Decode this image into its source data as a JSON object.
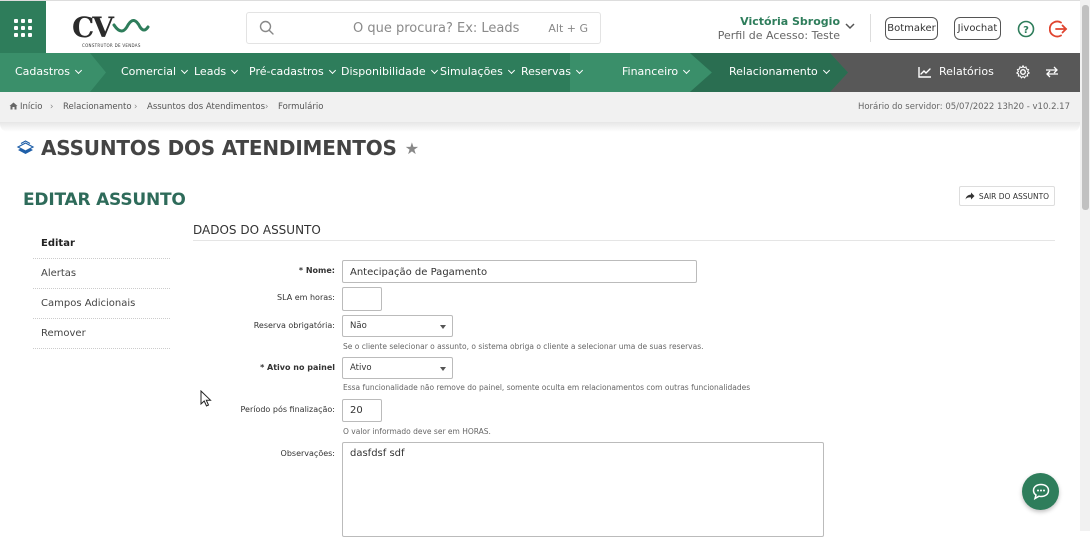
{
  "colors": {
    "brand_green": "#2e7d5b",
    "nav_dark": "#555555",
    "title_green": "#2e6b5a"
  },
  "logo": {
    "brand": "CV",
    "tagline": "CONSTRUTOR DE VENDAS"
  },
  "search": {
    "placeholder": "O que procura? Ex: Leads",
    "shortcut": "Alt + G"
  },
  "user": {
    "name": "Victória Sbrogio",
    "profile": "Perfil de Acesso: Teste"
  },
  "header_buttons": {
    "botmaker": "Botmaker",
    "jivochat": "Jivochat"
  },
  "nav": {
    "items": [
      {
        "label": "Cadastros"
      },
      {
        "label": "Comercial"
      },
      {
        "label": "Leads"
      },
      {
        "label": "Pré-cadastros"
      },
      {
        "label": "Disponibilidade"
      },
      {
        "label": "Simulações"
      },
      {
        "label": "Reservas"
      },
      {
        "label": "Financeiro"
      },
      {
        "label": "Relacionamento"
      }
    ],
    "reports": "Relatórios"
  },
  "breadcrumb": {
    "items": [
      "Início",
      "Relacionamento",
      "Assuntos dos Atendimentos",
      "Formulário"
    ],
    "server_time": "Horário do servidor: 05/07/2022 13h20 - v10.2.17"
  },
  "page": {
    "title": "ASSUNTOS DOS ATENDIMENTOS",
    "section_title": "EDITAR ASSUNTO",
    "exit_button": "SAIR DO ASSUNTO"
  },
  "side_menu": {
    "items": [
      "Editar",
      "Alertas",
      "Campos Adicionais",
      "Remover"
    ],
    "active": "Editar"
  },
  "form": {
    "heading": "DADOS DO ASSUNTO",
    "nome": {
      "label": "* Nome:",
      "value": "Antecipação de Pagamento"
    },
    "sla": {
      "label": "SLA em horas:",
      "value": ""
    },
    "reserva": {
      "label": "Reserva obrigatória:",
      "value": "Não",
      "hint": "Se o cliente selecionar o assunto, o sistema obriga o cliente a selecionar uma de suas reservas."
    },
    "ativo": {
      "label": "* Ativo no painel",
      "value": "Ativo",
      "hint": "Essa funcionalidade não remove do painel, somente oculta em relacionamentos com outras funcionalidades"
    },
    "periodo": {
      "label": "Período pós finalização:",
      "value": "20",
      "hint": "O valor informado deve ser em HORAS."
    },
    "observacoes": {
      "label": "Observações:",
      "value": "dasfdsf sdf"
    }
  }
}
